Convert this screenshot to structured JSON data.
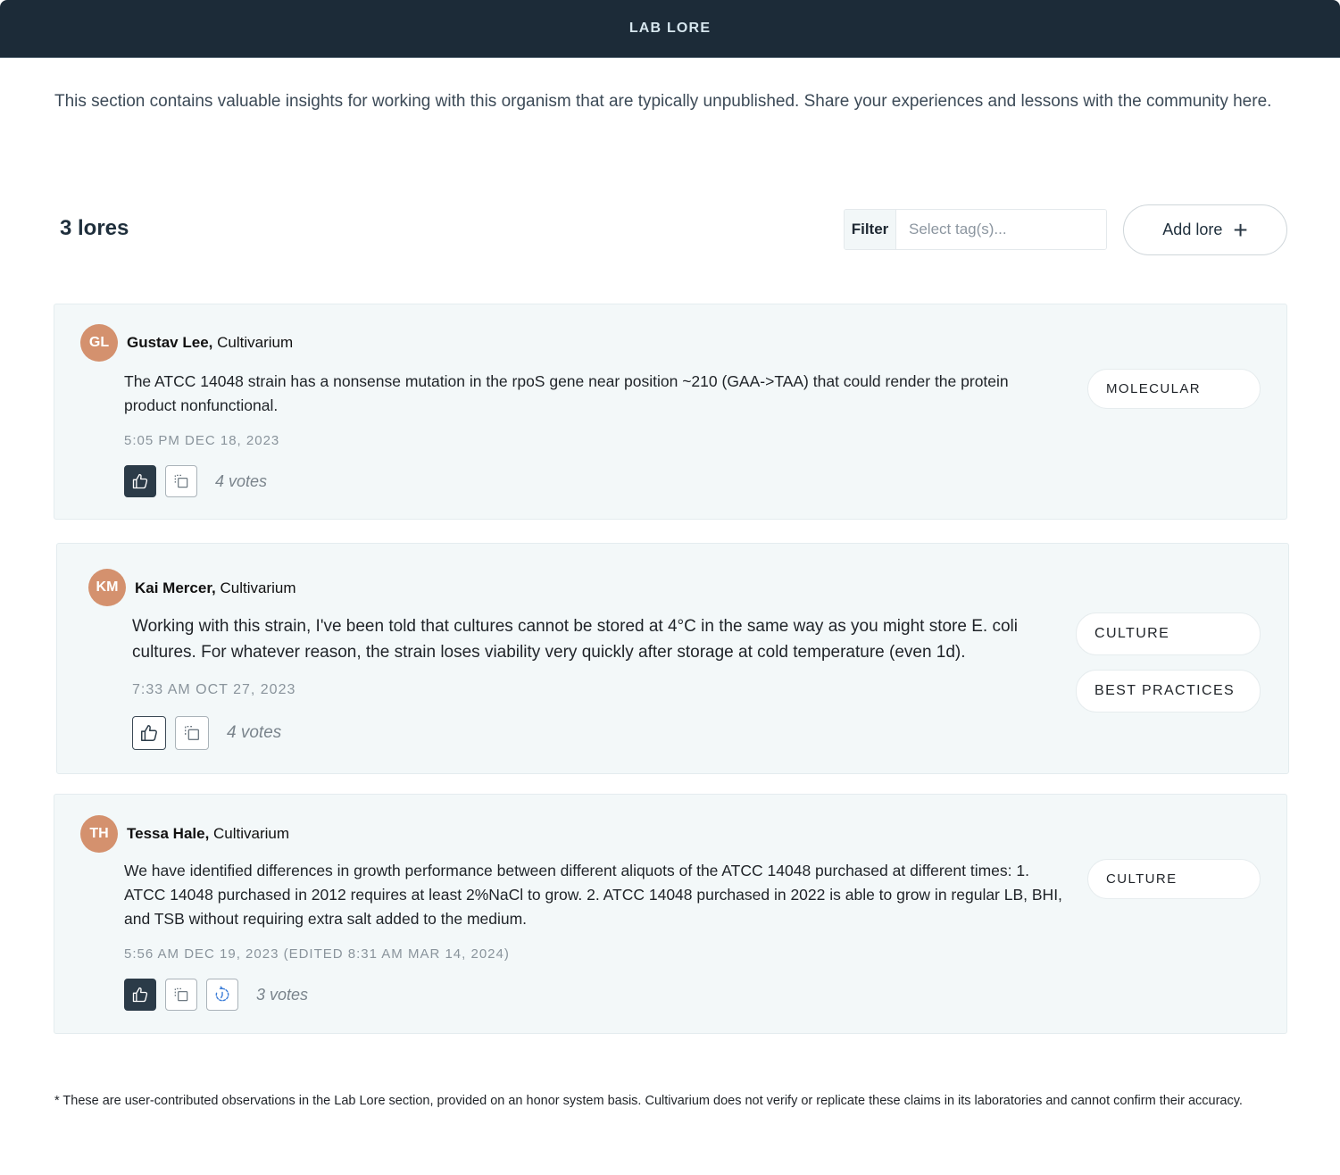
{
  "header": {
    "title": "LAB LORE"
  },
  "intro": "This section contains valuable insights for working with this organism that are typically unpublished. Share your experiences and lessons with the community here.",
  "toolbar": {
    "count_label": "3 lores",
    "filter_label": "Filter",
    "filter_placeholder": "Select tag(s)...",
    "filter_value": "",
    "add_label": "Add lore",
    "add_icon": "plus-icon"
  },
  "lores": [
    {
      "initials": "GL",
      "author": "Gustav Lee,",
      "org": "Cultivarium",
      "text": "The ATCC 14048 strain has a nonsense mutation in the rpoS gene near position ~210 (GAA->TAA) that could render the protein product nonfunctional.",
      "timestamp": "5:05 PM DEC 18, 2023",
      "upvoted": true,
      "votes": "4 votes",
      "tags": [
        "MOLECULAR"
      ]
    },
    {
      "initials": "KM",
      "author": "Kai Mercer,",
      "org": "Cultivarium",
      "text": "Working with this strain, I've been told that cultures cannot be stored at 4°C in the same way as you might store E. coli cultures. For whatever reason, the strain loses viability very quickly after storage at cold temperature (even 1d).",
      "timestamp": "7:33 AM OCT 27, 2023",
      "upvoted": false,
      "votes": "4 votes",
      "tags": [
        "CULTURE",
        "BEST PRACTICES"
      ]
    },
    {
      "initials": "TH",
      "author": "Tessa Hale,",
      "org": "Cultivarium",
      "text": "We have identified differences in growth performance between different aliquots of the ATCC 14048 purchased at different times: 1. ATCC 14048 purchased in 2012 requires at least 2%NaCl to grow. 2. ATCC 14048 purchased in 2022 is able to grow in regular LB, BHI, and TSB without requiring extra salt added to the medium.",
      "timestamp": "5:56 AM DEC 19, 2023 (EDITED 8:31 AM MAR 14, 2024)",
      "upvoted": true,
      "votes": "3 votes",
      "tags": [
        "CULTURE"
      ],
      "has_history": true
    }
  ],
  "disclaimer": "* These are user-contributed observations in the Lab Lore section, provided on an honor system basis. Cultivarium does not verify or replicate these claims in its laboratories and cannot confirm their accuracy.",
  "colors": {
    "header_bg": "#1c2b38",
    "avatar": "#d4916e",
    "card_bg": "#f3f8f9",
    "active_button": "#2b3b48",
    "history_icon": "#3b7dd8"
  }
}
